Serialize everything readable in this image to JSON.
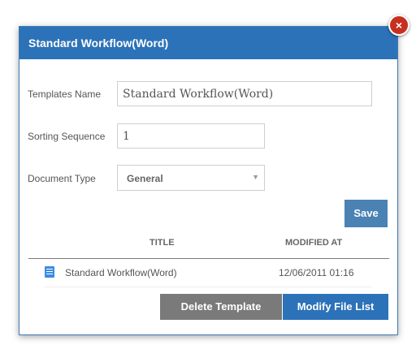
{
  "dialog": {
    "title": "Standard Workflow(Word)",
    "close_symbol": "×"
  },
  "form": {
    "template_name_label": "Templates Name",
    "template_name_value": "Standard Workflow(Word)",
    "sorting_label": "Sorting Sequence",
    "sorting_value": "1",
    "doc_type_label": "Document Type",
    "doc_type_value": "General",
    "dropdown_symbol": "▼"
  },
  "buttons": {
    "save": "Save",
    "delete": "Delete Template",
    "modify": "Modify File List"
  },
  "table": {
    "columns": [
      "TITLE",
      "MODIFIED AT"
    ],
    "rows": [
      {
        "icon": "document-icon",
        "title": "Standard Workflow(Word)",
        "modified": "12/06/2011 01:16"
      }
    ]
  },
  "colors": {
    "title_bar": "#2c72b8",
    "save_button": "#4a82b4",
    "delete_button": "#7a7a7a",
    "modify_button": "#2c72b8",
    "close_button": "#c7301f"
  }
}
